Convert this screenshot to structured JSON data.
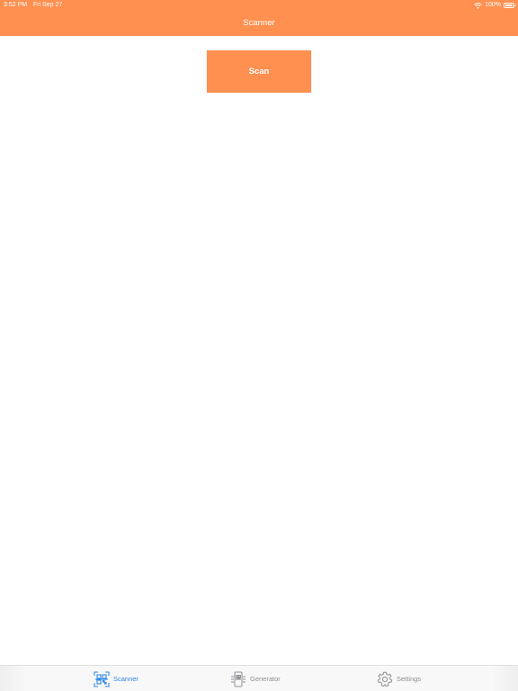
{
  "status_bar": {
    "time": "3:52 PM",
    "date": "Fri Sep 27",
    "battery": "100%"
  },
  "nav": {
    "title": "Scanner"
  },
  "main": {
    "scan_label": "Scan"
  },
  "tabs": [
    {
      "label": "Scanner",
      "icon": "qr-scan-icon",
      "active": true
    },
    {
      "label": "Generator",
      "icon": "qr-generator-icon",
      "active": false
    },
    {
      "label": "Settings",
      "icon": "gear-icon",
      "active": false
    }
  ],
  "colors": {
    "accent": "#ff9050",
    "active_tab": "#2f86e8",
    "inactive_tab": "#8e8e93"
  }
}
